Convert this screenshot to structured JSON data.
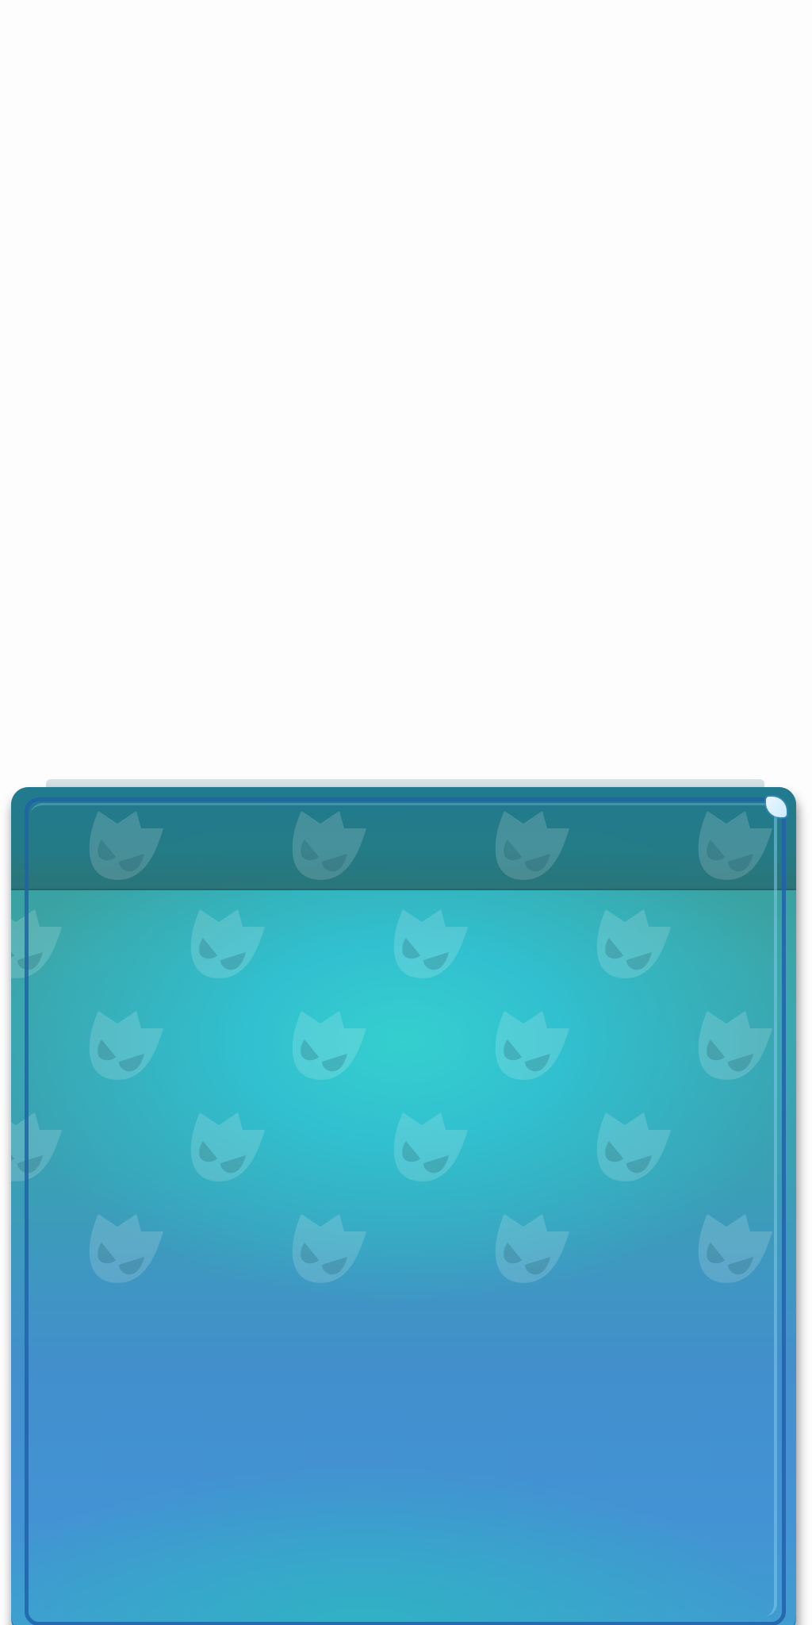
{
  "panel": {
    "title": "",
    "colors": {
      "header": "#237a86",
      "teal_glow": "#35cfcf",
      "blue_body": "#4392d3",
      "frame_stroke": "#2162aa",
      "corner_gem": "#cdeaff",
      "pattern_fill": "#ffffff"
    },
    "pattern_icon": "cat-mask-icon",
    "corner_icon": "corner-gem-icon"
  }
}
